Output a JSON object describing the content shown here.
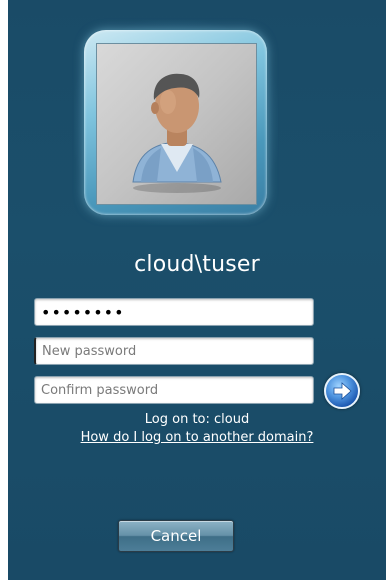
{
  "user": {
    "name": "cloud\\tuser"
  },
  "fields": {
    "current_password_value": "••••••••",
    "new_password_placeholder": "New password",
    "confirm_password_placeholder": "Confirm password"
  },
  "logon": {
    "logon_to_text": "Log on to: cloud",
    "other_domain_link": "How do I log on to another domain?"
  },
  "buttons": {
    "cancel_label": "Cancel",
    "submit_icon": "arrow-right-icon"
  },
  "colors": {
    "background": "#1b4d68",
    "text": "#ffffff",
    "go_button": "#2b6fc8"
  }
}
